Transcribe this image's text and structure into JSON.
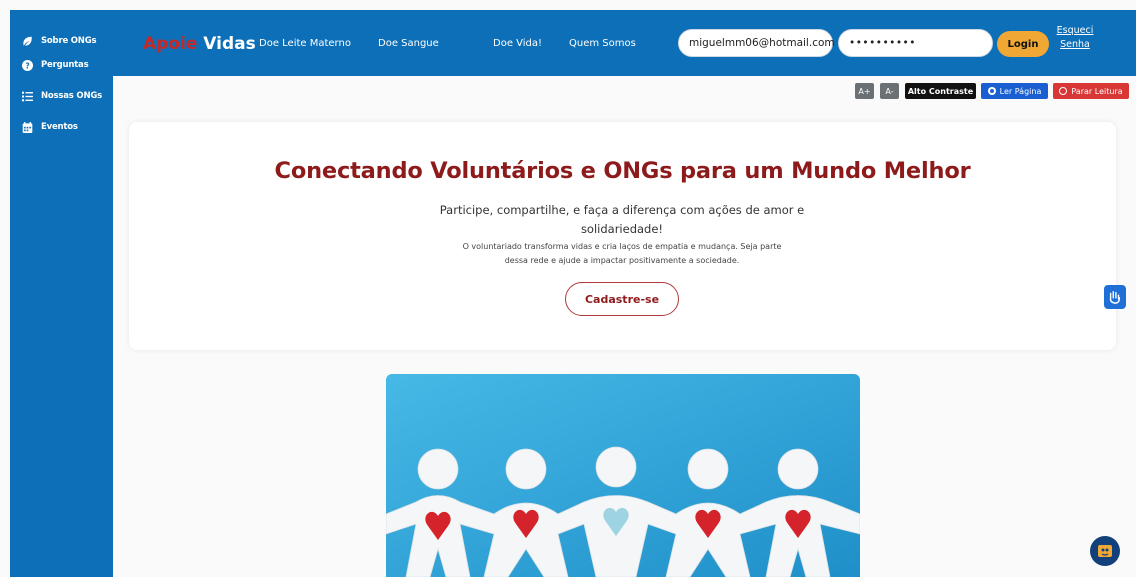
{
  "sidebar": {
    "items": [
      {
        "label": "Sobre ONGs",
        "icon": "leaf-icon"
      },
      {
        "label": "Perguntas",
        "icon": "question-icon"
      },
      {
        "label": "Nossas ONGs",
        "icon": "list-icon"
      },
      {
        "label": "Eventos",
        "icon": "calendar-icon"
      }
    ]
  },
  "header": {
    "brand_part1": "Apoie",
    "brand_part2": "Vidas",
    "nav": [
      "Doe Leite Materno",
      "Doe Sangue",
      "Doe Vida!",
      "Quem Somos"
    ],
    "email_value": "miguelmm06@hotmail.com",
    "password_value": "••••••••••",
    "login_label": "Login",
    "forgot_line1": "Esqueci",
    "forgot_line2": "Senha"
  },
  "accessibility": {
    "increase": "A+",
    "decrease": "A-",
    "contrast": "Alto Contraste",
    "read": "Ler Página",
    "stop": "Parar Leitura"
  },
  "hero": {
    "title": "Conectando Voluntários e ONGs para um Mundo Melhor",
    "subtitle_line1": "Participe, compartilhe, e faça a diferença com ações de amor e",
    "subtitle_line2": "solidariedade!",
    "small_line1": "O voluntariado transforma vidas e cria laços de empatia e mudança. Seja parte",
    "small_line2": "dessa rede e ajude a impactar positivamente a sociedade.",
    "cta": "Cadastre-se"
  },
  "colors": {
    "primary": "#0d6fb8",
    "brand_red": "#c62828",
    "title_red": "#8e1b1b",
    "login_orange": "#f0a734",
    "read_blue": "#1a5fd1",
    "stop_red": "#d93636"
  },
  "floating": {
    "sign_language": "hand-sign-icon",
    "assistant": "assistant-icon"
  }
}
